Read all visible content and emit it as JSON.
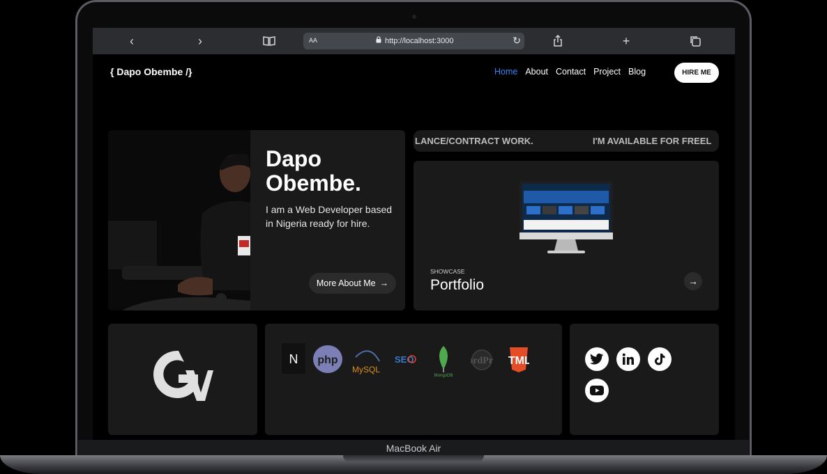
{
  "browser": {
    "text_size_label": "AA",
    "url": "http://localhost:3000"
  },
  "header": {
    "brand": "{ Dapo Obembe /}",
    "nav": [
      "Home",
      "About",
      "Contact",
      "Project",
      "Blog"
    ],
    "hire_label": "HIRE ME"
  },
  "hero": {
    "name_line1": "Dapo",
    "name_line2": "Obembe.",
    "description": "I am a Web Developer based in Nigeria ready for hire.",
    "more_label": "More About Me"
  },
  "marquee": {
    "text_a": "LANCE/CONTRACT WORK.",
    "text_b": "I'M AVAILABLE FOR FREEL"
  },
  "portfolio": {
    "label": "SHOWCASE",
    "title": "Portfolio"
  },
  "tech_stack": [
    "N",
    "php",
    "MySQL",
    "SEO",
    "MongoDB",
    "WordPress",
    "HTML5"
  ],
  "logo_mark": "GV",
  "device_label": "MacBook Air",
  "colors": {
    "accent": "#3b82f6",
    "card": "#1a1a1a",
    "background": "#000000"
  }
}
